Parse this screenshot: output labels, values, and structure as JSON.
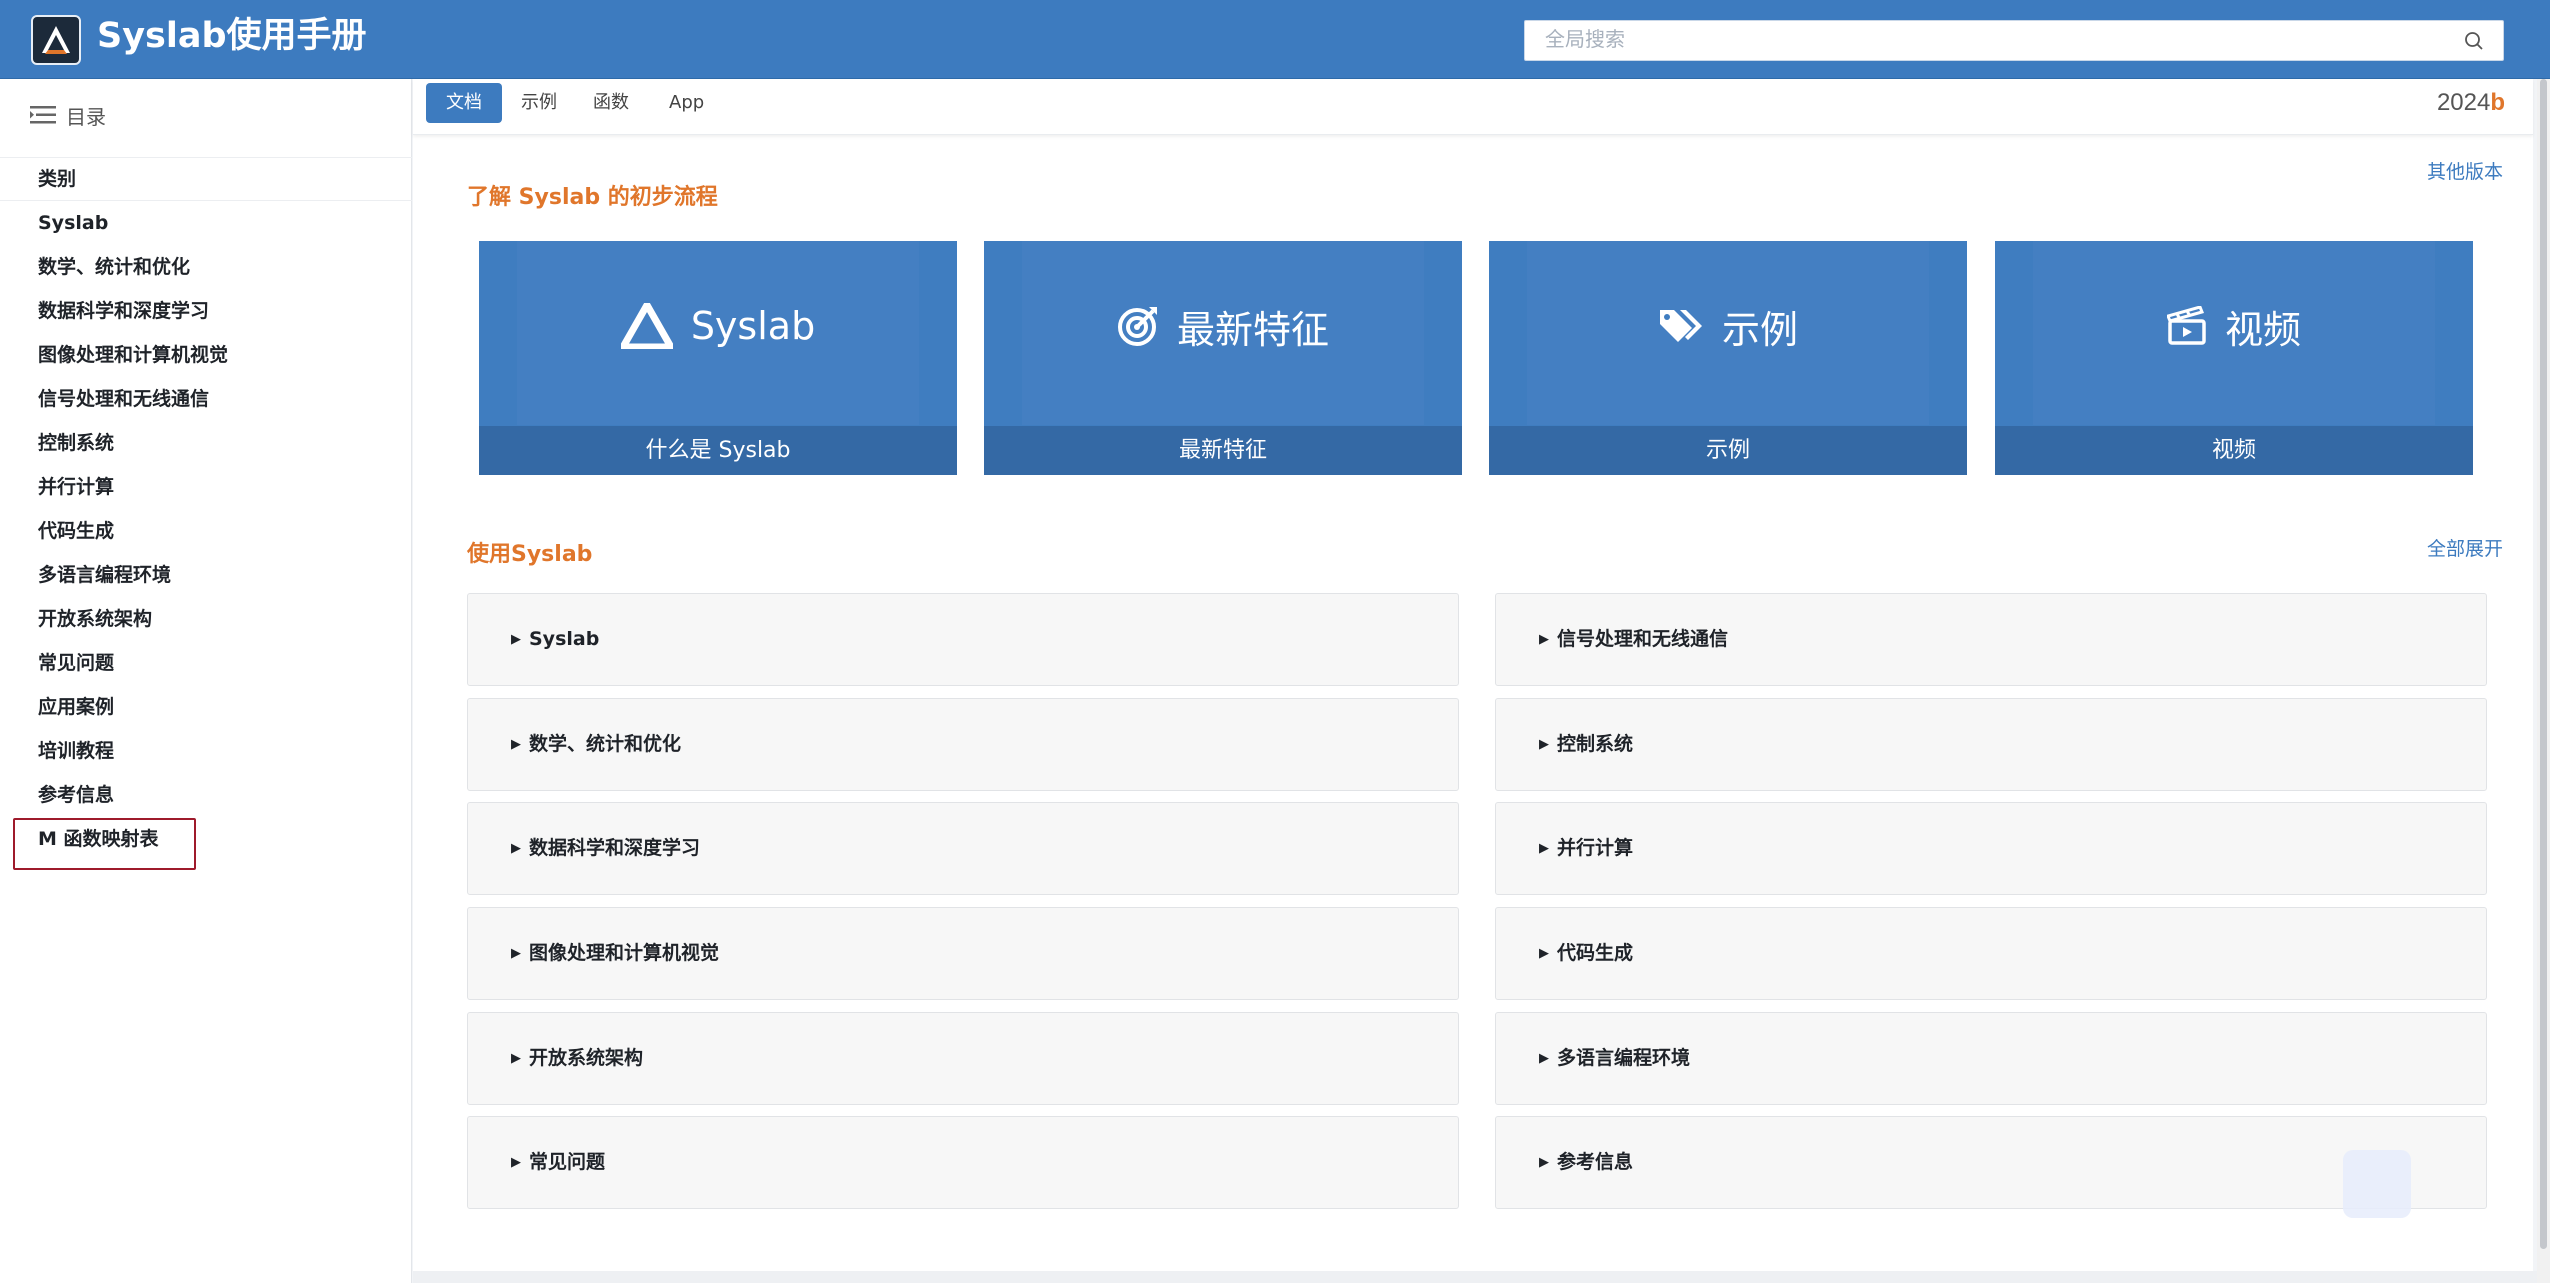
{
  "app": {
    "title": "Syslab使用手册"
  },
  "search": {
    "placeholder": "全局搜索"
  },
  "sidebar": {
    "header_label": "目录",
    "items": [
      {
        "label": "类别"
      },
      {
        "label": "Syslab"
      },
      {
        "label": "数学、统计和优化"
      },
      {
        "label": "数据科学和深度学习"
      },
      {
        "label": "图像处理和计算机视觉"
      },
      {
        "label": "信号处理和无线通信"
      },
      {
        "label": "控制系统"
      },
      {
        "label": "并行计算"
      },
      {
        "label": "代码生成"
      },
      {
        "label": "多语言编程环境"
      },
      {
        "label": "开放系统架构"
      },
      {
        "label": "常见问题"
      },
      {
        "label": "应用案例"
      },
      {
        "label": "培训教程"
      },
      {
        "label": "参考信息"
      },
      {
        "label": "M 函数映射表"
      }
    ]
  },
  "tabs": [
    {
      "label": "文档"
    },
    {
      "label": "示例"
    },
    {
      "label": "函数"
    },
    {
      "label": "App"
    }
  ],
  "version": {
    "number": "2024",
    "suffix": "b"
  },
  "other_versions_label": "其他版本",
  "getting_started": {
    "title": "了解 Syslab 的初步流程",
    "cards": [
      {
        "head": "Syslab",
        "foot": "什么是 Syslab"
      },
      {
        "head": "最新特征",
        "foot": "最新特征"
      },
      {
        "head": "示例",
        "foot": "示例"
      },
      {
        "head": "视频",
        "foot": "视频"
      }
    ]
  },
  "using": {
    "title": "使用Syslab",
    "expand_all_label": "全部展开",
    "left": [
      "Syslab",
      "数学、统计和优化",
      "数据科学和深度学习",
      "图像处理和计算机视觉",
      "开放系统架构",
      "常见问题"
    ],
    "right": [
      "信号处理和无线通信",
      "控制系统",
      "并行计算",
      "代码生成",
      "多语言编程环境",
      "参考信息"
    ]
  },
  "colors": {
    "header": "#3d7bbf",
    "accent": "#e0762b",
    "card": "#3f7dc0",
    "card_footer": "#3469a5"
  }
}
